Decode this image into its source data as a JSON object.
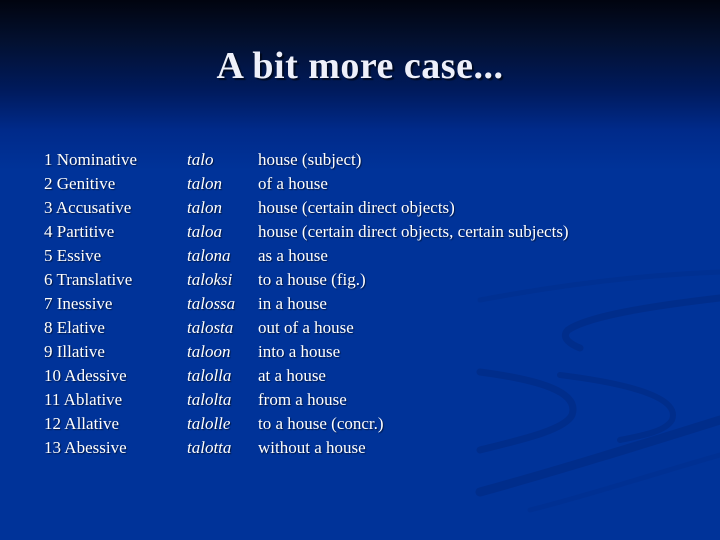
{
  "slide": {
    "title": "A bit more case...",
    "rows": [
      {
        "case": "1 Nominative",
        "form": "talo",
        "meaning": "house (subject)"
      },
      {
        "case": "2 Genitive",
        "form": "talon",
        "meaning": "of a house"
      },
      {
        "case": "3 Accusative",
        "form": "talon",
        "meaning": "house  (certain direct objects)"
      },
      {
        "case": "4 Partitive",
        "form": "taloa",
        "meaning": "house (certain direct objects, certain subjects)"
      },
      {
        "case": "5 Essive",
        "form": "talona",
        "meaning": "as a house"
      },
      {
        "case": "6 Translative",
        "form": "taloksi",
        "meaning": "to a house (fig.)"
      },
      {
        "case": "7 Inessive",
        "form": "talossa",
        "meaning": "in a house"
      },
      {
        "case": "8  Elative",
        "form": "talosta",
        "meaning": "out of a house"
      },
      {
        "case": "9  Illative",
        "form": "taloon",
        "meaning": "into a house"
      },
      {
        "case": "10 Adessive",
        "form": "talolla",
        "meaning": "at a house"
      },
      {
        "case": "11 Ablative",
        "form": "talolta",
        "meaning": "from a house"
      },
      {
        "case": "12 Allative",
        "form": "talolle",
        "meaning": "to a house (concr.)"
      },
      {
        "case": "13 Abessive",
        "form": "talotta",
        "meaning": "without a house"
      }
    ]
  },
  "colors": {
    "background_top": "#01040f",
    "background_main": "#003399",
    "text": "#ffffff"
  }
}
